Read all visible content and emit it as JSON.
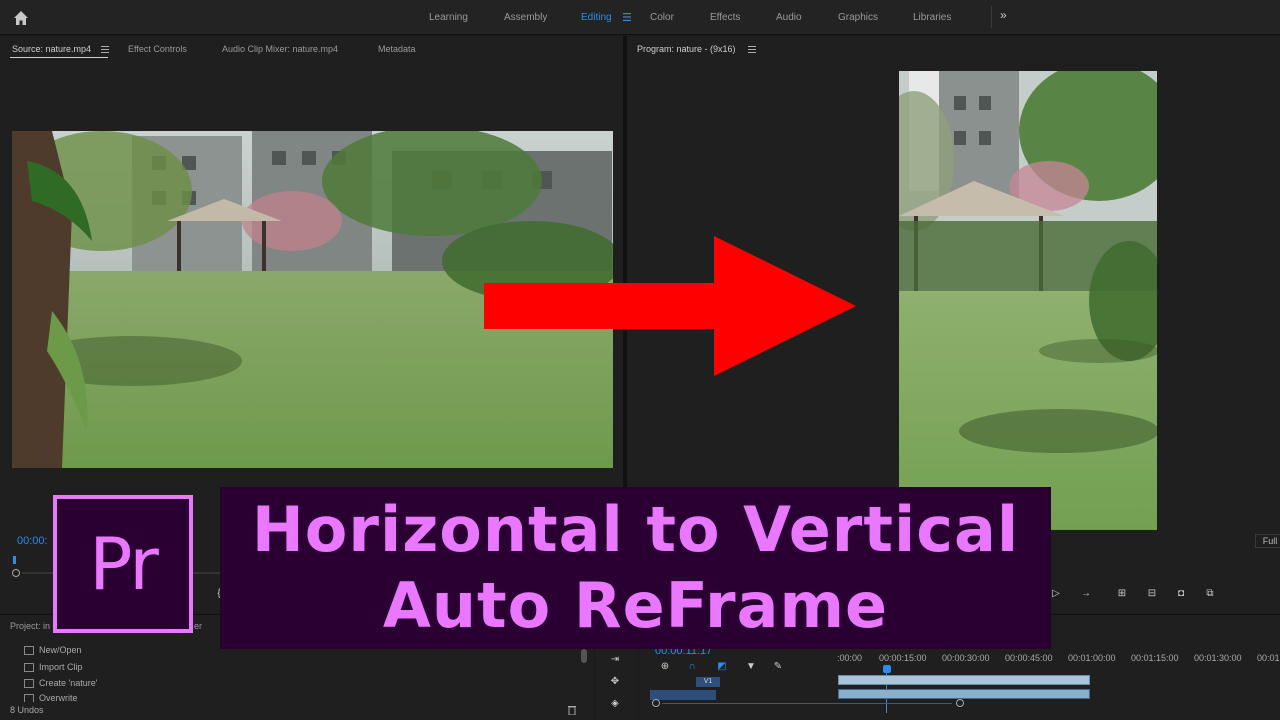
{
  "workspaces": [
    {
      "label": "Learning",
      "active": false
    },
    {
      "label": "Assembly",
      "active": false
    },
    {
      "label": "Editing",
      "active": true
    },
    {
      "label": "Color",
      "active": false
    },
    {
      "label": "Effects",
      "active": false
    },
    {
      "label": "Audio",
      "active": false
    },
    {
      "label": "Graphics",
      "active": false
    },
    {
      "label": "Libraries",
      "active": false
    }
  ],
  "source_tabs": [
    "Source: nature.mp4",
    "Effect Controls",
    "Audio Clip Mixer: nature.mp4",
    "Metadata"
  ],
  "program_tab": "Program: nature - (9x16)",
  "source_timecode": "00:00:",
  "fit_label": "Full",
  "project_tab": "Project: in",
  "project_tab_tail": "er",
  "history_items": [
    "New/Open",
    "Import Clip",
    "Create 'nature'",
    "Overwrite"
  ],
  "undo_count": "8 Undos",
  "timeline_timecode": "00:00:11:17",
  "track_label": "V1",
  "ruler_ticks": [
    ":00:00",
    "00:00:15:00",
    "00:00:30:00",
    "00:00:45:00",
    "00:01:00:00",
    "00:01:15:00",
    "00:01:30:00",
    "00:01"
  ],
  "overlay": {
    "logo_text": "Pr",
    "title_line1": "Horizontal to Vertical",
    "title_line2": "Auto ReFrame"
  },
  "colors": {
    "accent_blue": "#2d8ceb",
    "overlay_pink": "#ea77ff",
    "overlay_bg": "#2a0033",
    "arrow_red": "#ff0000"
  },
  "icons": [
    "home-icon",
    "workspace-menu-icon",
    "more-workspaces-icon",
    "panel-menu-icon",
    "step-forward-icon",
    "export-frame-icon",
    "trash-icon",
    "selection-tool-icon",
    "track-select-icon",
    "razor-tool-icon",
    "snap-icon",
    "linked-selection-icon",
    "add-marker-icon",
    "wrench-icon",
    "arrow-icon"
  ]
}
